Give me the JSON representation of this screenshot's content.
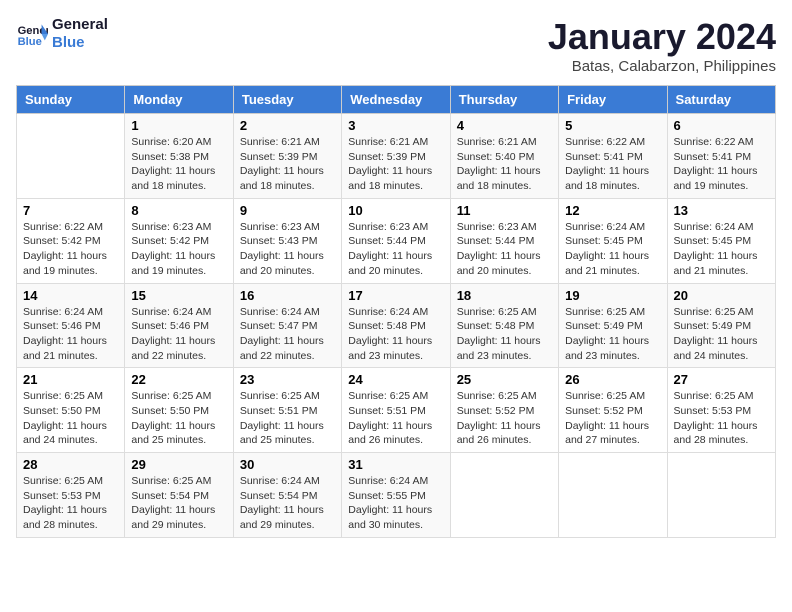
{
  "logo": {
    "line1": "General",
    "line2": "Blue"
  },
  "title": "January 2024",
  "subtitle": "Batas, Calabarzon, Philippines",
  "headers": [
    "Sunday",
    "Monday",
    "Tuesday",
    "Wednesday",
    "Thursday",
    "Friday",
    "Saturday"
  ],
  "weeks": [
    [
      {
        "day": "",
        "sunrise": "",
        "sunset": "",
        "daylight": ""
      },
      {
        "day": "1",
        "sunrise": "Sunrise: 6:20 AM",
        "sunset": "Sunset: 5:38 PM",
        "daylight": "Daylight: 11 hours and 18 minutes."
      },
      {
        "day": "2",
        "sunrise": "Sunrise: 6:21 AM",
        "sunset": "Sunset: 5:39 PM",
        "daylight": "Daylight: 11 hours and 18 minutes."
      },
      {
        "day": "3",
        "sunrise": "Sunrise: 6:21 AM",
        "sunset": "Sunset: 5:39 PM",
        "daylight": "Daylight: 11 hours and 18 minutes."
      },
      {
        "day": "4",
        "sunrise": "Sunrise: 6:21 AM",
        "sunset": "Sunset: 5:40 PM",
        "daylight": "Daylight: 11 hours and 18 minutes."
      },
      {
        "day": "5",
        "sunrise": "Sunrise: 6:22 AM",
        "sunset": "Sunset: 5:41 PM",
        "daylight": "Daylight: 11 hours and 18 minutes."
      },
      {
        "day": "6",
        "sunrise": "Sunrise: 6:22 AM",
        "sunset": "Sunset: 5:41 PM",
        "daylight": "Daylight: 11 hours and 19 minutes."
      }
    ],
    [
      {
        "day": "7",
        "sunrise": "Sunrise: 6:22 AM",
        "sunset": "Sunset: 5:42 PM",
        "daylight": "Daylight: 11 hours and 19 minutes."
      },
      {
        "day": "8",
        "sunrise": "Sunrise: 6:23 AM",
        "sunset": "Sunset: 5:42 PM",
        "daylight": "Daylight: 11 hours and 19 minutes."
      },
      {
        "day": "9",
        "sunrise": "Sunrise: 6:23 AM",
        "sunset": "Sunset: 5:43 PM",
        "daylight": "Daylight: 11 hours and 20 minutes."
      },
      {
        "day": "10",
        "sunrise": "Sunrise: 6:23 AM",
        "sunset": "Sunset: 5:44 PM",
        "daylight": "Daylight: 11 hours and 20 minutes."
      },
      {
        "day": "11",
        "sunrise": "Sunrise: 6:23 AM",
        "sunset": "Sunset: 5:44 PM",
        "daylight": "Daylight: 11 hours and 20 minutes."
      },
      {
        "day": "12",
        "sunrise": "Sunrise: 6:24 AM",
        "sunset": "Sunset: 5:45 PM",
        "daylight": "Daylight: 11 hours and 21 minutes."
      },
      {
        "day": "13",
        "sunrise": "Sunrise: 6:24 AM",
        "sunset": "Sunset: 5:45 PM",
        "daylight": "Daylight: 11 hours and 21 minutes."
      }
    ],
    [
      {
        "day": "14",
        "sunrise": "Sunrise: 6:24 AM",
        "sunset": "Sunset: 5:46 PM",
        "daylight": "Daylight: 11 hours and 21 minutes."
      },
      {
        "day": "15",
        "sunrise": "Sunrise: 6:24 AM",
        "sunset": "Sunset: 5:46 PM",
        "daylight": "Daylight: 11 hours and 22 minutes."
      },
      {
        "day": "16",
        "sunrise": "Sunrise: 6:24 AM",
        "sunset": "Sunset: 5:47 PM",
        "daylight": "Daylight: 11 hours and 22 minutes."
      },
      {
        "day": "17",
        "sunrise": "Sunrise: 6:24 AM",
        "sunset": "Sunset: 5:48 PM",
        "daylight": "Daylight: 11 hours and 23 minutes."
      },
      {
        "day": "18",
        "sunrise": "Sunrise: 6:25 AM",
        "sunset": "Sunset: 5:48 PM",
        "daylight": "Daylight: 11 hours and 23 minutes."
      },
      {
        "day": "19",
        "sunrise": "Sunrise: 6:25 AM",
        "sunset": "Sunset: 5:49 PM",
        "daylight": "Daylight: 11 hours and 23 minutes."
      },
      {
        "day": "20",
        "sunrise": "Sunrise: 6:25 AM",
        "sunset": "Sunset: 5:49 PM",
        "daylight": "Daylight: 11 hours and 24 minutes."
      }
    ],
    [
      {
        "day": "21",
        "sunrise": "Sunrise: 6:25 AM",
        "sunset": "Sunset: 5:50 PM",
        "daylight": "Daylight: 11 hours and 24 minutes."
      },
      {
        "day": "22",
        "sunrise": "Sunrise: 6:25 AM",
        "sunset": "Sunset: 5:50 PM",
        "daylight": "Daylight: 11 hours and 25 minutes."
      },
      {
        "day": "23",
        "sunrise": "Sunrise: 6:25 AM",
        "sunset": "Sunset: 5:51 PM",
        "daylight": "Daylight: 11 hours and 25 minutes."
      },
      {
        "day": "24",
        "sunrise": "Sunrise: 6:25 AM",
        "sunset": "Sunset: 5:51 PM",
        "daylight": "Daylight: 11 hours and 26 minutes."
      },
      {
        "day": "25",
        "sunrise": "Sunrise: 6:25 AM",
        "sunset": "Sunset: 5:52 PM",
        "daylight": "Daylight: 11 hours and 26 minutes."
      },
      {
        "day": "26",
        "sunrise": "Sunrise: 6:25 AM",
        "sunset": "Sunset: 5:52 PM",
        "daylight": "Daylight: 11 hours and 27 minutes."
      },
      {
        "day": "27",
        "sunrise": "Sunrise: 6:25 AM",
        "sunset": "Sunset: 5:53 PM",
        "daylight": "Daylight: 11 hours and 28 minutes."
      }
    ],
    [
      {
        "day": "28",
        "sunrise": "Sunrise: 6:25 AM",
        "sunset": "Sunset: 5:53 PM",
        "daylight": "Daylight: 11 hours and 28 minutes."
      },
      {
        "day": "29",
        "sunrise": "Sunrise: 6:25 AM",
        "sunset": "Sunset: 5:54 PM",
        "daylight": "Daylight: 11 hours and 29 minutes."
      },
      {
        "day": "30",
        "sunrise": "Sunrise: 6:24 AM",
        "sunset": "Sunset: 5:54 PM",
        "daylight": "Daylight: 11 hours and 29 minutes."
      },
      {
        "day": "31",
        "sunrise": "Sunrise: 6:24 AM",
        "sunset": "Sunset: 5:55 PM",
        "daylight": "Daylight: 11 hours and 30 minutes."
      },
      {
        "day": "",
        "sunrise": "",
        "sunset": "",
        "daylight": ""
      },
      {
        "day": "",
        "sunrise": "",
        "sunset": "",
        "daylight": ""
      },
      {
        "day": "",
        "sunrise": "",
        "sunset": "",
        "daylight": ""
      }
    ]
  ]
}
